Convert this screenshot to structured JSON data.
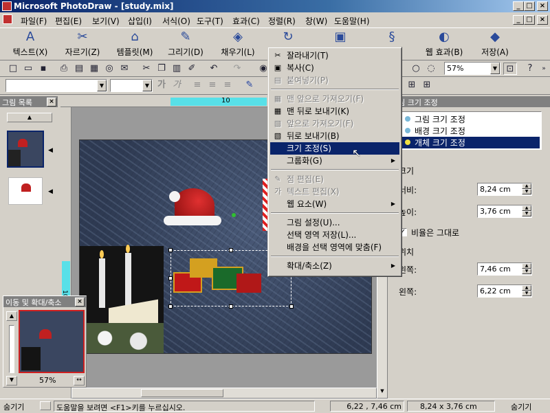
{
  "window": {
    "title": "Microsoft PhotoDraw - [study.mix]",
    "minimize": "_",
    "maximize": "□",
    "close": "×"
  },
  "menubar": [
    "파일(F)",
    "편집(E)",
    "보기(V)",
    "삽입(I)",
    "서식(O)",
    "도구(T)",
    "효과(C)",
    "정렬(R)",
    "창(W)",
    "도움말(H)"
  ],
  "big_toolbar": [
    {
      "label": "텍스트(X)",
      "icon": "text-icon"
    },
    {
      "label": "자르기(Z)",
      "icon": "scissors-icon"
    },
    {
      "label": "템플릿(M)",
      "icon": "template-icon"
    },
    {
      "label": "그리기(D)",
      "icon": "draw-icon"
    },
    {
      "label": "채우기(L)",
      "icon": "fill-icon"
    },
    {
      "label": "",
      "icon": "rotate-icon"
    },
    {
      "label": "",
      "icon": "effects-icon"
    },
    {
      "label": "",
      "icon": "distort-icon"
    },
    {
      "label": "웹 효과(B)",
      "icon": "web-effects-icon"
    },
    {
      "label": "저장(A)",
      "icon": "save-icon"
    }
  ],
  "zoom": {
    "value": "57%"
  },
  "format_bar": {
    "bold": "가",
    "italic": "가"
  },
  "ruler": {
    "mark": "10",
    "vmark": "10"
  },
  "left_panel": {
    "title": "그림 목록"
  },
  "navigator": {
    "title": "이동 및 확대/축소",
    "zoom": "57%"
  },
  "context_menu": [
    {
      "label": "잘라내기(T)",
      "enabled": true,
      "icon": "✂"
    },
    {
      "label": "복사(C)",
      "enabled": true,
      "icon": "▣"
    },
    {
      "label": "붙여넣기(P)",
      "enabled": false,
      "icon": "▤"
    },
    {
      "sep": true
    },
    {
      "label": "맨 앞으로 가져오기(F)",
      "enabled": false,
      "icon": "▦"
    },
    {
      "label": "맨 뒤로 보내기(K)",
      "enabled": true,
      "icon": "▦"
    },
    {
      "label": "앞으로 가져오기(F)",
      "enabled": false,
      "icon": "▧"
    },
    {
      "label": "뒤로 보내기(B)",
      "enabled": true,
      "icon": "▧"
    },
    {
      "label": "크기 조정(S)",
      "enabled": true,
      "selected": true,
      "icon": ""
    },
    {
      "label": "그룹화(G)",
      "enabled": true,
      "submenu": true,
      "icon": ""
    },
    {
      "sep": true
    },
    {
      "label": "점 편집(E)",
      "enabled": false,
      "icon": "✎"
    },
    {
      "label": "텍스트 편집(X)",
      "enabled": false,
      "icon": "가"
    },
    {
      "label": "웹 요소(W)",
      "enabled": true,
      "submenu": true,
      "icon": ""
    },
    {
      "sep": true
    },
    {
      "label": "그림 설정(U)...",
      "enabled": true,
      "icon": ""
    },
    {
      "label": "선택 영역 저장(L)...",
      "enabled": true,
      "icon": ""
    },
    {
      "label": "배경을 선택 영역에 맞춤(F)",
      "enabled": true,
      "icon": ""
    },
    {
      "sep": true
    },
    {
      "label": "확대/축소(Z)",
      "enabled": true,
      "submenu": true,
      "icon": ""
    }
  ],
  "right_panel": {
    "title": "그림 크기 조정",
    "options": [
      {
        "label": "그림 크기 조정",
        "selected": false
      },
      {
        "label": "배경 크기 조정",
        "selected": false
      },
      {
        "label": "개체 크기 조정",
        "selected": true
      }
    ],
    "size_heading": "크기",
    "width_label": "너비:",
    "width_value": "8,24 cm",
    "height_label": "높이:",
    "height_value": "3,76 cm",
    "keep_ratio_label": "비율은 그대로",
    "keep_ratio_checked": true,
    "position_heading": "위치",
    "left_label": "왼쪽:",
    "left_value": "7,46 cm",
    "top_label": "왼쪽:",
    "top_value": "6,22 cm"
  },
  "statusbar": {
    "hide_left": "숨기기",
    "help": "도움말을 보려면 <F1>키를 누르십시오.",
    "position": "6,22 , 7,46 cm",
    "size": "8,24 x 3,76 cm",
    "hide_right": "숨기기"
  }
}
